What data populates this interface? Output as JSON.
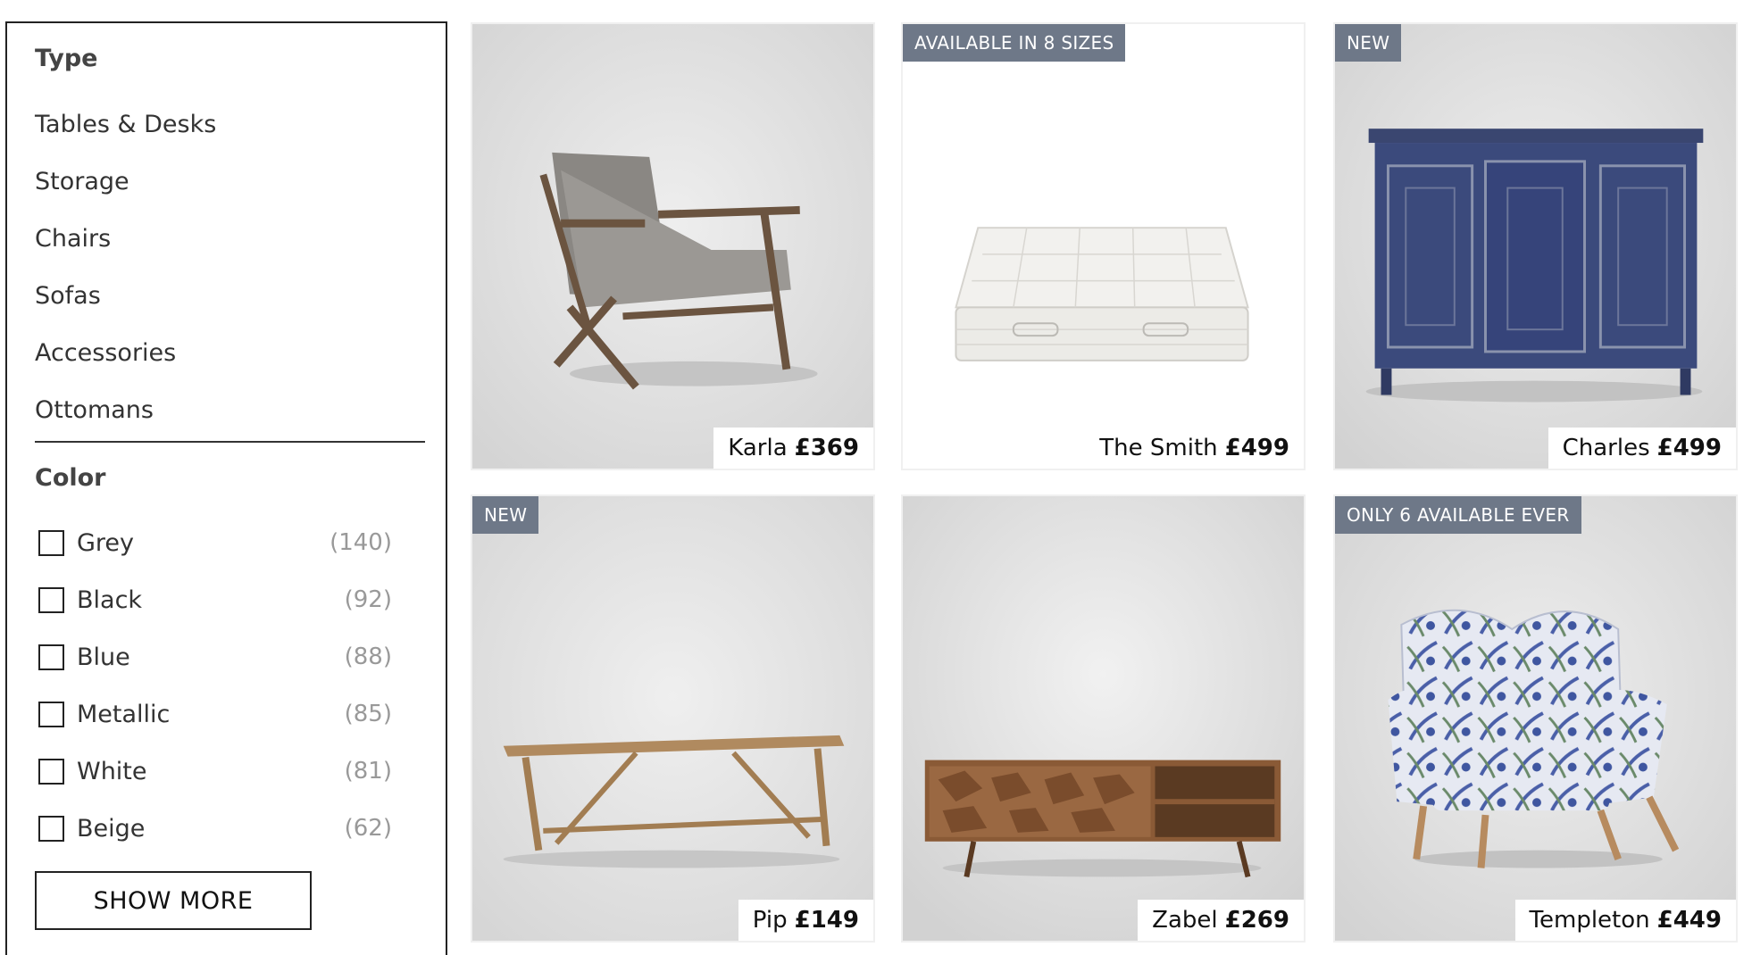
{
  "filters": {
    "type_title": "Type",
    "types": [
      {
        "label": "Tables & Desks"
      },
      {
        "label": "Storage"
      },
      {
        "label": "Chairs"
      },
      {
        "label": "Sofas"
      },
      {
        "label": "Accessories"
      },
      {
        "label": "Ottomans"
      }
    ],
    "color_title": "Color",
    "colors": [
      {
        "label": "Grey",
        "count": "(140)",
        "checked": false
      },
      {
        "label": "Black",
        "count": "(92)",
        "checked": false
      },
      {
        "label": "Blue",
        "count": "(88)",
        "checked": false
      },
      {
        "label": "Metallic",
        "count": "(85)",
        "checked": false
      },
      {
        "label": "White",
        "count": "(81)",
        "checked": false
      },
      {
        "label": "Beige",
        "count": "(62)",
        "checked": false
      }
    ],
    "show_more_label": "SHOW MORE"
  },
  "products": [
    {
      "name": "Karla",
      "price": "£369",
      "badge": ""
    },
    {
      "name": "The Smith",
      "price": "£499",
      "badge": "AVAILABLE IN 8 SIZES"
    },
    {
      "name": "Charles",
      "price": "£499",
      "badge": "NEW"
    },
    {
      "name": "Pip",
      "price": "£149",
      "badge": "NEW"
    },
    {
      "name": "Zabel",
      "price": "£269",
      "badge": ""
    },
    {
      "name": "Templeton",
      "price": "£449",
      "badge": "ONLY 6 AVAILABLE EVER"
    }
  ],
  "colors": {
    "badge_bg": "#6e7888",
    "border": "#222222",
    "count_text": "#999999"
  }
}
